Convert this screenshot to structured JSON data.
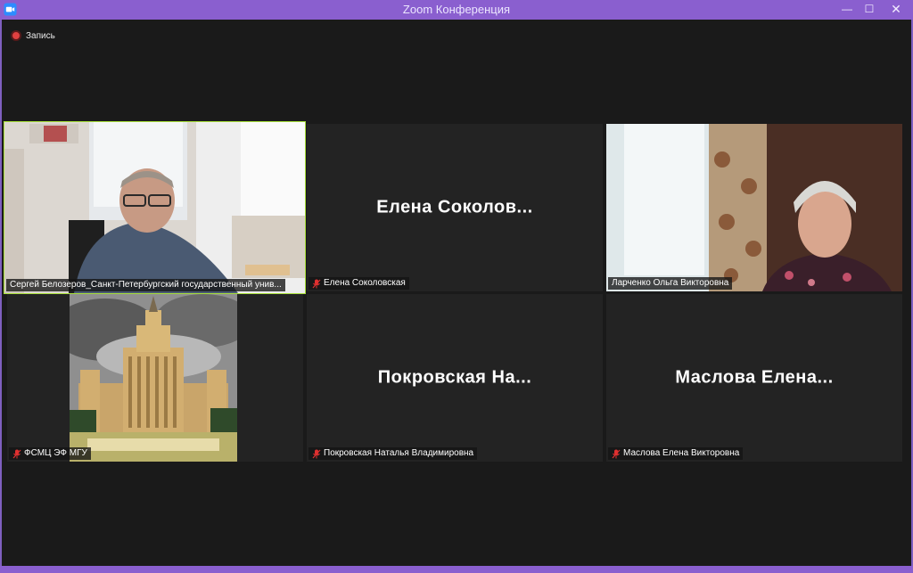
{
  "window": {
    "title": "Zoom Конференция",
    "controls": {
      "minimize": "—",
      "maximize": "☐",
      "close": "✕"
    }
  },
  "recording": {
    "label": "Запись"
  },
  "participants": [
    {
      "name_tag": "Сергей Белозеров_Санкт-Петербургский государственный унив...",
      "video": true,
      "active_speaker": true,
      "muted": false
    },
    {
      "name_tag": "Елена Соколовская",
      "display_name": "Елена  Соколов...",
      "video": false,
      "muted": true
    },
    {
      "name_tag": "Ларченко Ольга Викторовна",
      "video": true,
      "muted": false
    },
    {
      "name_tag": "ФСМЦ ЭФ МГУ",
      "video": true,
      "muted": true
    },
    {
      "name_tag": "Покровская Наталья Владимировна",
      "display_name": "Покровская  На...",
      "video": false,
      "muted": true
    },
    {
      "name_tag": "Маслова Елена Викторовна",
      "display_name": "Маслова  Елена...",
      "video": false,
      "muted": true
    }
  ],
  "colors": {
    "title_bar": "#8a5fcf",
    "stage_bg": "#1a1a1a",
    "tile_bg": "#232323",
    "active_speaker_border": "#a8e03a",
    "mute_icon": "#e03030",
    "record_dot": "#e04040"
  }
}
